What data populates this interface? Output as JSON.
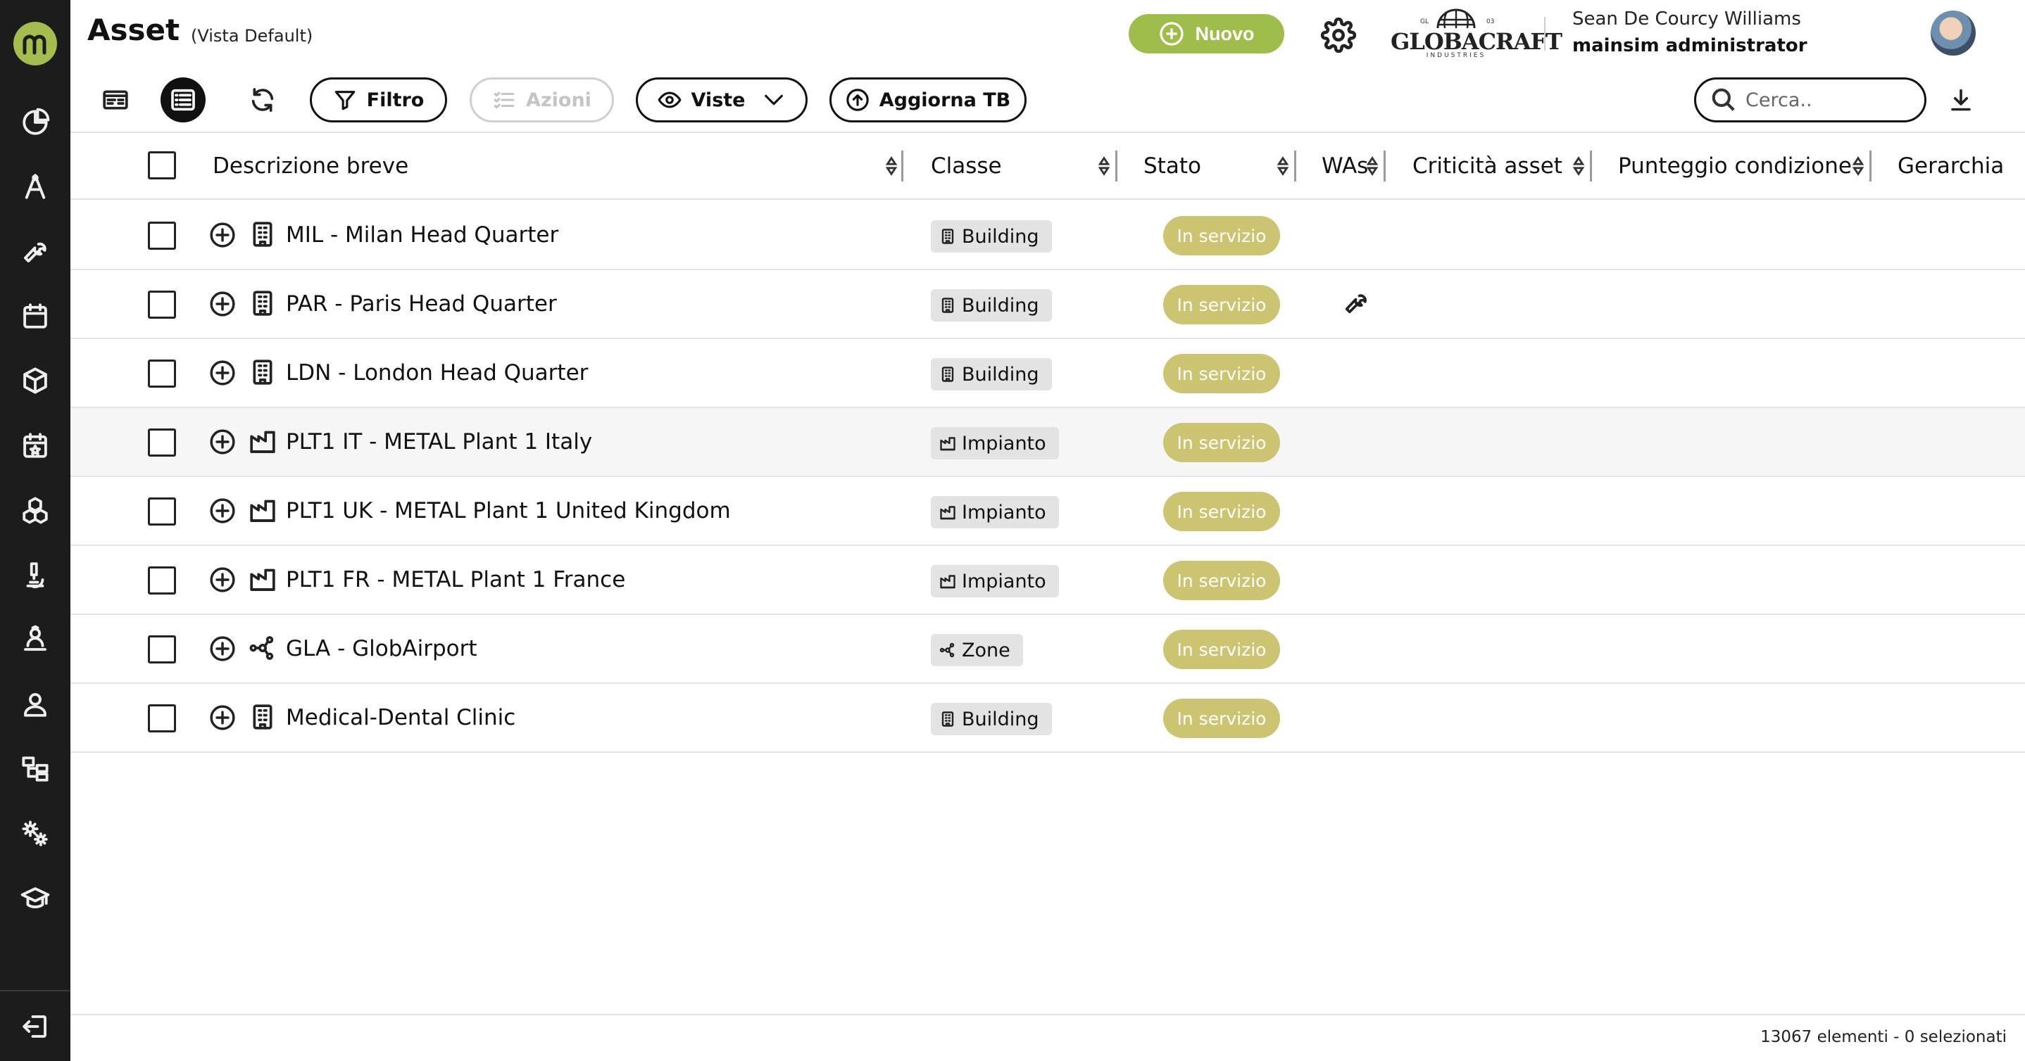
{
  "header": {
    "title": "Asset",
    "view_label": "(Vista Default)",
    "new_button": "Nuovo",
    "brand": {
      "gl": "GL",
      "name": "GLOBACRAFT",
      "number": "03",
      "sub": "INDUSTRIES"
    },
    "user": {
      "name": "Sean De Courcy Williams",
      "role": "mainsim administrator"
    }
  },
  "sidebar": {
    "items": [
      {
        "icon": "pie-chart-icon"
      },
      {
        "icon": "compass-drafting-icon"
      },
      {
        "icon": "wrench-icon"
      },
      {
        "icon": "calendar-icon"
      },
      {
        "icon": "box-icon"
      },
      {
        "icon": "calendar-star-icon"
      },
      {
        "icon": "boxes-icon"
      },
      {
        "icon": "microscope-icon"
      },
      {
        "icon": "user-badge-icon"
      },
      {
        "icon": "user-icon"
      },
      {
        "icon": "hierarchy-icon"
      },
      {
        "icon": "gears-icon"
      },
      {
        "icon": "graduation-cap-icon"
      }
    ],
    "logout_icon": "logout-icon"
  },
  "toolbar": {
    "filter_label": "Filtro",
    "actions_label": "Azioni",
    "views_label": "Viste",
    "update_tb_label": "Aggiorna TB",
    "search_placeholder": "Cerca.."
  },
  "table": {
    "columns": {
      "description": "Descrizione breve",
      "class": "Classe",
      "status": "Stato",
      "was": "WAs",
      "criticality": "Criticità asset",
      "condition": "Punteggio condizione",
      "hierarchy": "Gerarchia"
    },
    "rows": [
      {
        "description": "MIL - Milan Head Quarter",
        "type": "building",
        "class": "Building",
        "status": "In servizio",
        "was": false
      },
      {
        "description": "PAR - Paris Head Quarter",
        "type": "building",
        "class": "Building",
        "status": "In servizio",
        "was": true
      },
      {
        "description": "LDN - London Head Quarter",
        "type": "building",
        "class": "Building",
        "status": "In servizio",
        "was": false
      },
      {
        "description": "PLT1 IT - METAL Plant 1 Italy",
        "type": "plant",
        "class": "Impianto",
        "status": "In servizio",
        "was": false
      },
      {
        "description": "PLT1 UK - METAL Plant 1 United Kingdom",
        "type": "plant",
        "class": "Impianto",
        "status": "In servizio",
        "was": false
      },
      {
        "description": "PLT1 FR - METAL Plant 1 France",
        "type": "plant",
        "class": "Impianto",
        "status": "In servizio",
        "was": false
      },
      {
        "description": "GLA - GlobAirport",
        "type": "zone",
        "class": "Zone",
        "status": "In servizio",
        "was": false
      },
      {
        "description": "Medical-Dental Clinic",
        "type": "building",
        "class": "Building",
        "status": "In servizio",
        "was": false
      }
    ]
  },
  "footer": {
    "count": "13067 elementi - 0 selezionati"
  },
  "colors": {
    "accent": "#9ebd4a",
    "status": "#ccc471",
    "sidebar": "#1c1c1c"
  }
}
